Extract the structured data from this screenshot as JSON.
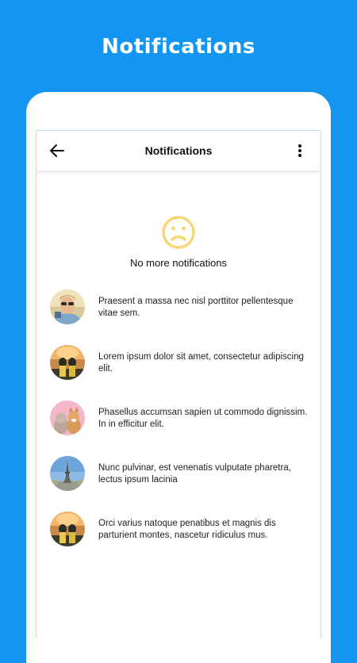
{
  "promo": {
    "title": "Notifications"
  },
  "appbar": {
    "title": "Notifications",
    "back_icon": "arrow-left-icon",
    "menu_icon": "more-vertical-icon"
  },
  "empty_state": {
    "icon": "sad-face-icon",
    "message": "No more notifications"
  },
  "colors": {
    "background": "#1496f0",
    "accent_icon": "#f7d774"
  },
  "notifications": [
    {
      "line1": "Praesent a massa nec nisl porttitor pellentesque",
      "line2": "vitae sem.",
      "avatar": "woman-sunglasses-photo"
    },
    {
      "line1": "Lorem ipsum dolor sit amet, consectetur adipiscing",
      "line2": "elit.",
      "avatar": "couple-sunset-photo"
    },
    {
      "line1": "Phasellus accumsan sapien ut commodo dignissim.",
      "line2": "In in efficitur elit.",
      "avatar": "dogs-photo"
    },
    {
      "line1": "Nunc pulvinar, est venenatis vulputate pharetra,",
      "line2": "lectus ipsum lacinia",
      "avatar": "eiffel-tower-photo"
    },
    {
      "line1": "Orci varius natoque penatibus et magnis dis",
      "line2": "parturient montes, nascetur ridiculus mus.",
      "avatar": "couple-sunset-photo"
    }
  ]
}
